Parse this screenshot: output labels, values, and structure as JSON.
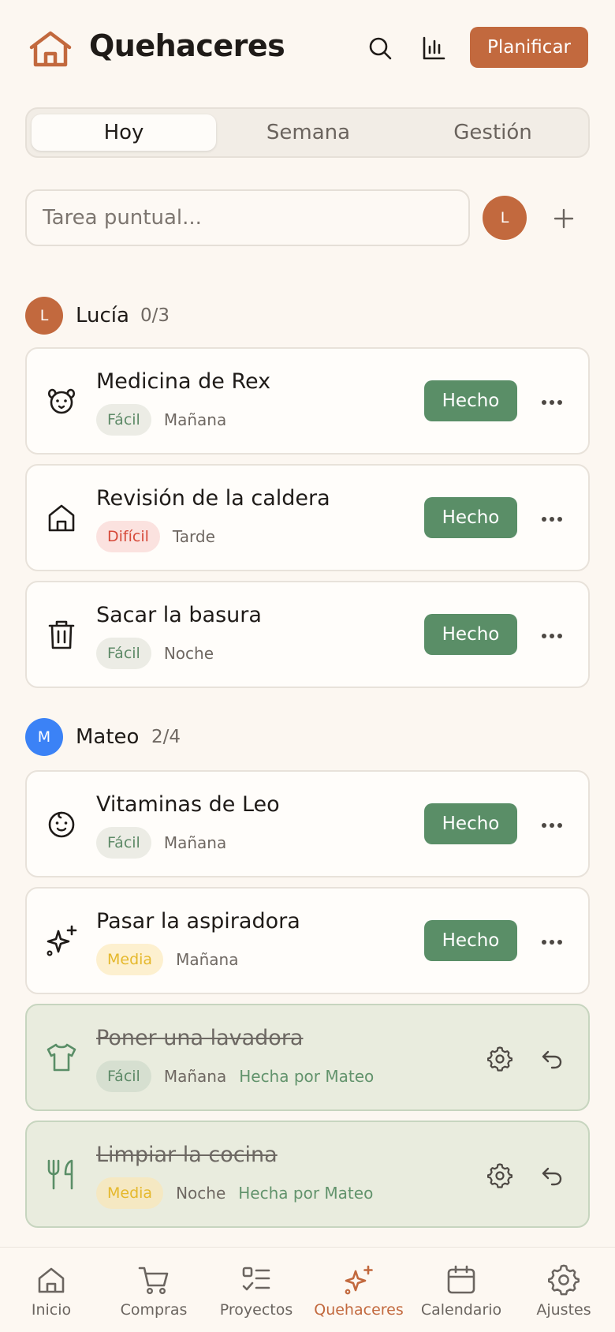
{
  "header": {
    "title": "Quehaceres",
    "plan_label": "Planificar",
    "icons": [
      "home-icon",
      "search-icon",
      "bar-chart-icon"
    ]
  },
  "tabs": [
    {
      "label": "Hoy",
      "active": true
    },
    {
      "label": "Semana",
      "active": false
    },
    {
      "label": "Gestión",
      "active": false
    }
  ],
  "quick_add": {
    "placeholder": "Tarea puntual...",
    "value": "",
    "avatar_initial": "L"
  },
  "sections": [
    {
      "initial": "L",
      "name": "Lucía",
      "count": "0/3",
      "color": "#c2693e",
      "tasks": [
        {
          "title": "Medicina de Rex",
          "difficulty": "Fácil",
          "time": "Mañana",
          "icon": "dog-icon",
          "done": false
        },
        {
          "title": "Revisión de la caldera",
          "difficulty": "Difícil",
          "time": "Tarde",
          "icon": "home-icon",
          "done": false
        },
        {
          "title": "Sacar la basura",
          "difficulty": "Fácil",
          "time": "Noche",
          "icon": "trash-icon",
          "done": false
        }
      ]
    },
    {
      "initial": "M",
      "name": "Mateo",
      "count": "2/4",
      "color": "#3b82f6",
      "tasks": [
        {
          "title": "Vitaminas de Leo",
          "difficulty": "Fácil",
          "time": "Mañana",
          "icon": "baby-icon",
          "done": false
        },
        {
          "title": "Pasar la aspiradora",
          "difficulty": "Media",
          "time": "Mañana",
          "icon": "sparkles-icon",
          "done": false
        },
        {
          "title": "Poner una lavadora",
          "difficulty": "Fácil",
          "time": "Mañana",
          "icon": "shirt-icon",
          "done": true,
          "done_by": "Hecha por Mateo"
        },
        {
          "title": "Limpiar la cocina",
          "difficulty": "Media",
          "time": "Noche",
          "icon": "utensils-icon",
          "done": true,
          "done_by": "Hecha por Mateo"
        }
      ]
    }
  ],
  "done_label": "Hecho",
  "nav": [
    {
      "label": "Inicio",
      "icon": "home-icon",
      "active": false
    },
    {
      "label": "Compras",
      "icon": "cart-icon",
      "active": false
    },
    {
      "label": "Proyectos",
      "icon": "list-check-icon",
      "active": false
    },
    {
      "label": "Quehaceres",
      "icon": "sparkles-icon",
      "active": true
    },
    {
      "label": "Calendario",
      "icon": "calendar-icon",
      "active": false
    },
    {
      "label": "Ajustes",
      "icon": "gear-icon",
      "active": false
    }
  ],
  "colors": {
    "accent": "#c2693e",
    "done_green": "#5a8e67",
    "background": "#fcf7f1"
  }
}
